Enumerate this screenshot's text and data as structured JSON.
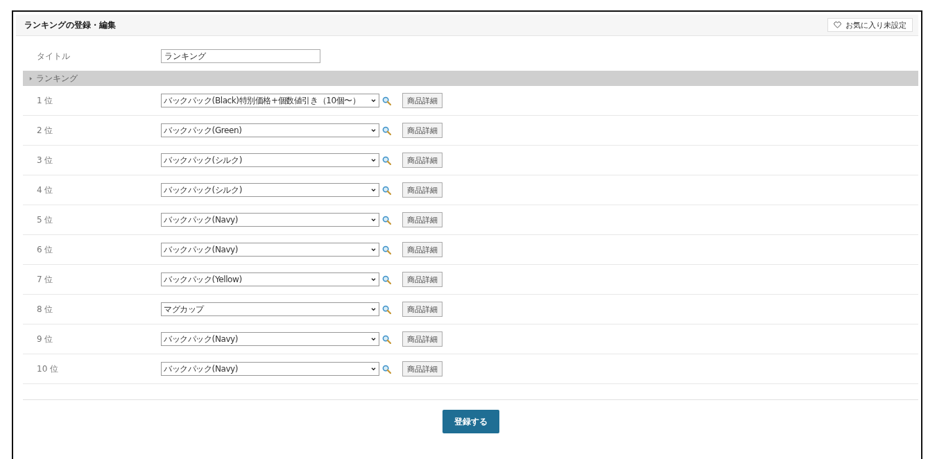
{
  "header": {
    "title": "ランキングの登録・編集",
    "favorite_button": "お気に入り未設定"
  },
  "title_field": {
    "label": "タイトル",
    "value": "ランキング"
  },
  "section": {
    "label": "ランキング",
    "expanded": true
  },
  "rankings": [
    {
      "rank": "1 位",
      "product": "バックパック(Black)特別価格+個数値引き（10個〜）",
      "detail_button": "商品詳細"
    },
    {
      "rank": "2 位",
      "product": "バックパック(Green)",
      "detail_button": "商品詳細"
    },
    {
      "rank": "3 位",
      "product": "バックパック(シルク)",
      "detail_button": "商品詳細"
    },
    {
      "rank": "4 位",
      "product": "バックパック(シルク)",
      "detail_button": "商品詳細"
    },
    {
      "rank": "5 位",
      "product": "バックパック(Navy)",
      "detail_button": "商品詳細"
    },
    {
      "rank": "6 位",
      "product": "バックパック(Navy)",
      "detail_button": "商品詳細"
    },
    {
      "rank": "7 位",
      "product": "バックパック(Yellow)",
      "detail_button": "商品詳細"
    },
    {
      "rank": "8 位",
      "product": "マグカップ",
      "detail_button": "商品詳細"
    },
    {
      "rank": "9 位",
      "product": "バックパック(Navy)",
      "detail_button": "商品詳細"
    },
    {
      "rank": "10 位",
      "product": "バックパック(Navy)",
      "detail_button": "商品詳細"
    }
  ],
  "submit_button": "登録する"
}
